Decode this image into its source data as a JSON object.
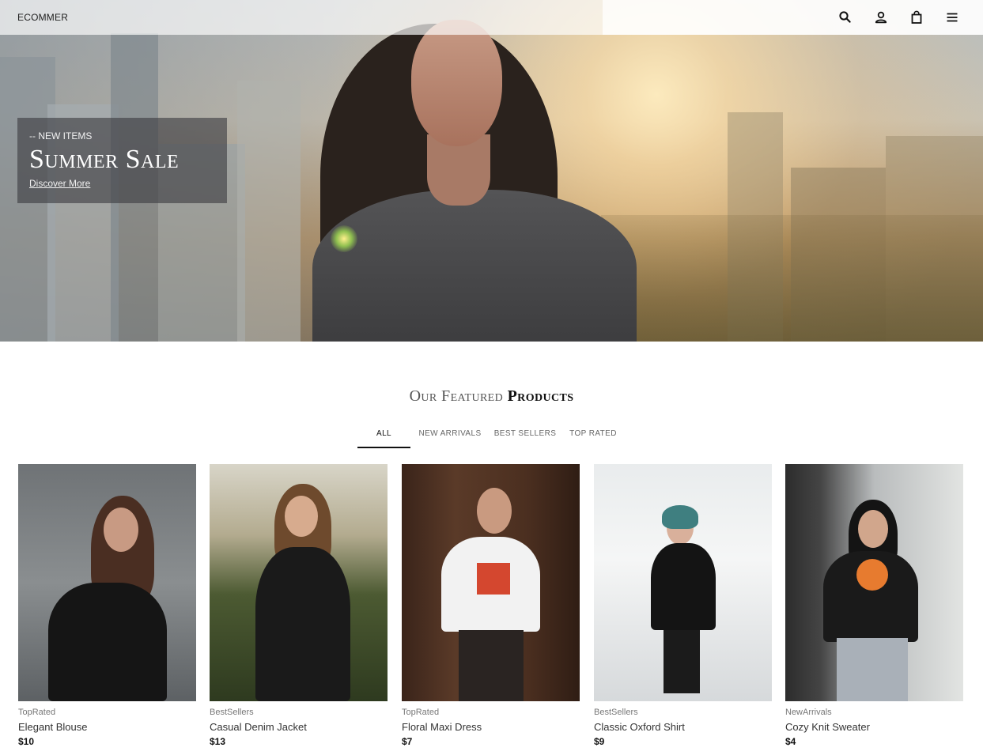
{
  "header": {
    "logo": "ECOMMER",
    "icons": [
      "search-icon",
      "user-icon",
      "shopping-bag-icon",
      "menu-icon"
    ]
  },
  "hero": {
    "kicker": "-- NEW ITEMS",
    "title": "Summer Sale",
    "link": "Discover More"
  },
  "featured": {
    "title_part1": "Our Featured",
    "title_part2": "Products",
    "tabs": [
      {
        "label": "ALL",
        "active": true
      },
      {
        "label": "NEW ARRIVALS",
        "active": false
      },
      {
        "label": "BEST SELLERS",
        "active": false
      },
      {
        "label": "TOP RATED",
        "active": false
      }
    ],
    "products": [
      {
        "category": "TopRated",
        "name": "Elegant Blouse",
        "price": "$10"
      },
      {
        "category": "BestSellers",
        "name": "Casual Denim Jacket",
        "price": "$13"
      },
      {
        "category": "TopRated",
        "name": "Floral Maxi Dress",
        "price": "$7"
      },
      {
        "category": "BestSellers",
        "name": "Classic Oxford Shirt",
        "price": "$9"
      },
      {
        "category": "NewArrivals",
        "name": "Cozy Knit Sweater",
        "price": "$4"
      }
    ]
  },
  "colors": {
    "accent": "#111111",
    "muted_text": "#777777"
  }
}
